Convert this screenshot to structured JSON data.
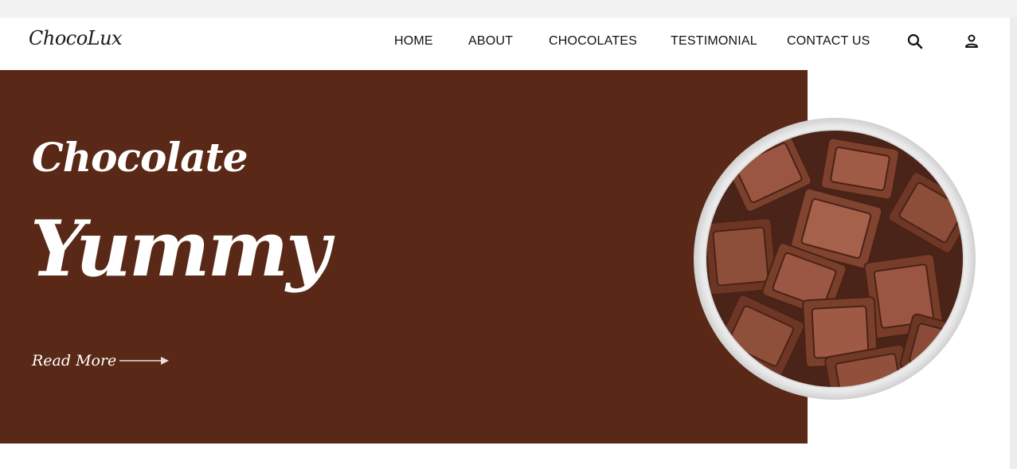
{
  "header": {
    "logo": "ChocoLux",
    "nav": [
      {
        "label": "HOME"
      },
      {
        "label": "ABOUT"
      },
      {
        "label": "CHOCOLATES"
      },
      {
        "label": "TESTIMONIAL"
      },
      {
        "label": "CONTACT US"
      }
    ],
    "icons": [
      "search-icon",
      "user-icon"
    ]
  },
  "hero": {
    "subtitle": "Chocolate",
    "title": "Yummy",
    "read_more": "Read More"
  },
  "colors": {
    "hero_bg": "#5a2816",
    "chocolate": "#7a3f2b",
    "chocolate_light": "#9a5642",
    "bowl": "#f4f4f4"
  }
}
